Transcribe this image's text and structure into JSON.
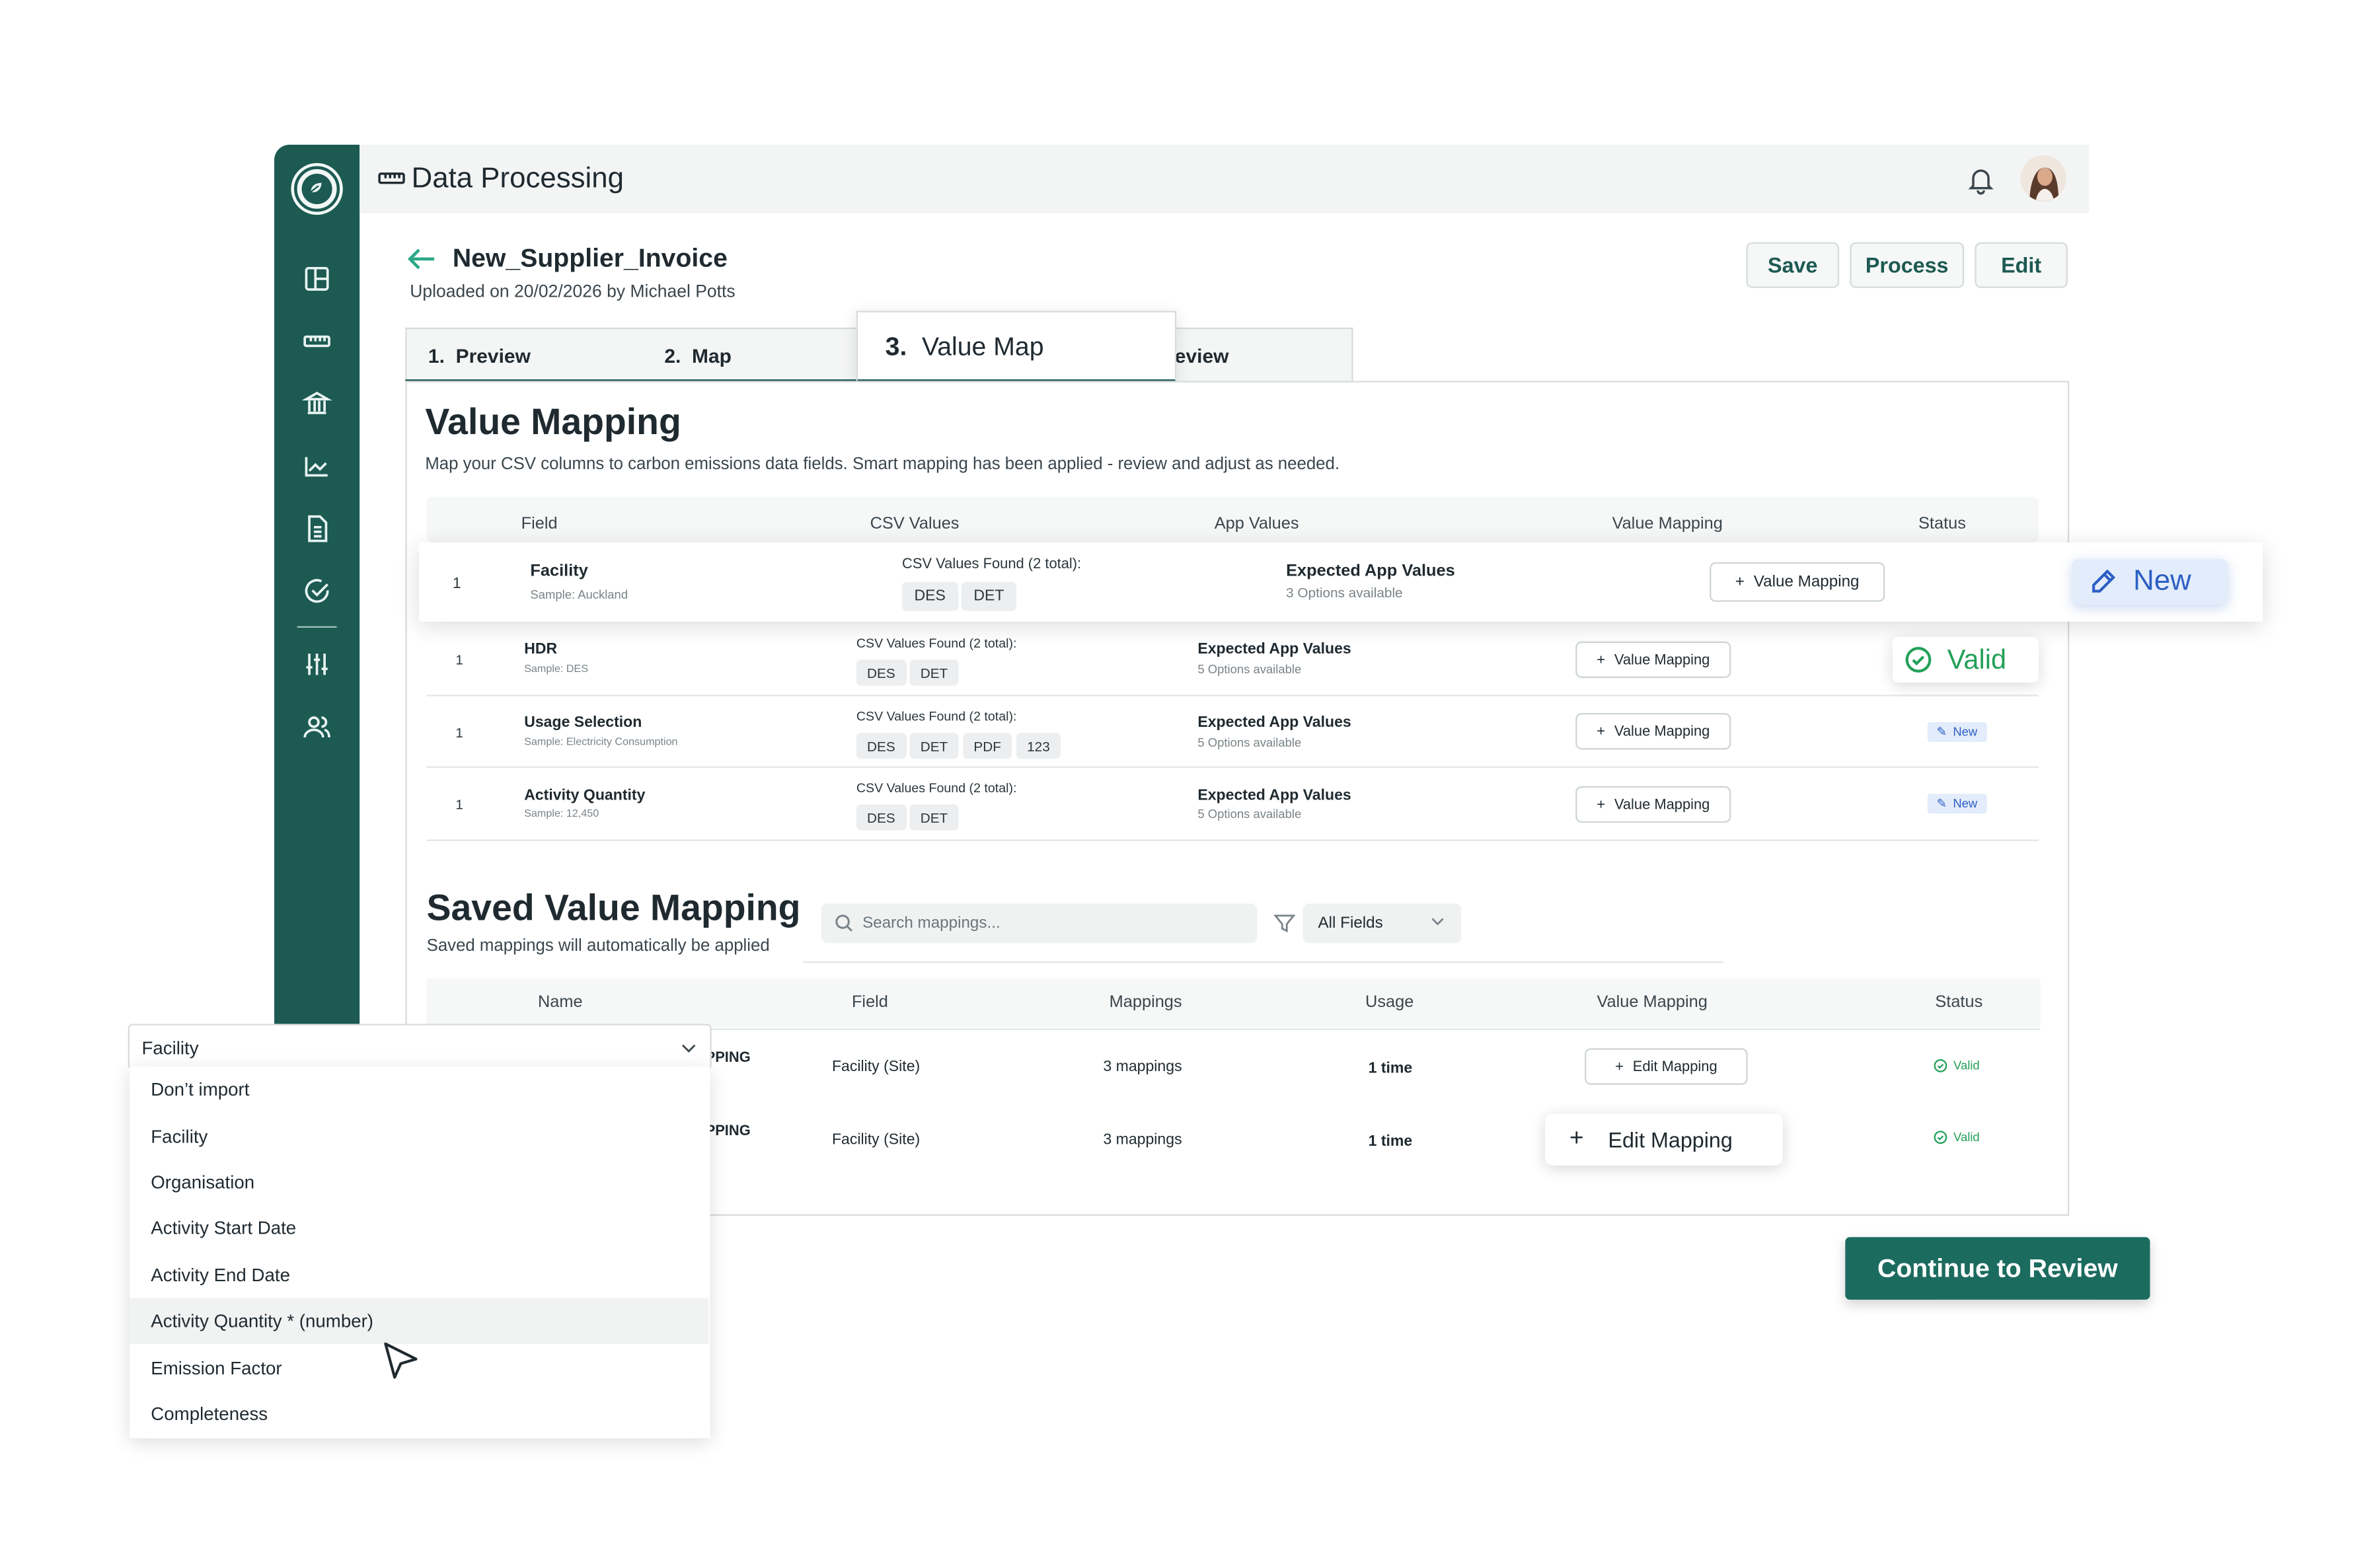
{
  "header": {
    "title": "Data Processing"
  },
  "file": {
    "name": "New_Supplier_Invoice",
    "uploaded": "Uploaded on 20/02/2026 by Michael Potts"
  },
  "actions": {
    "save": "Save",
    "process": "Process",
    "edit": "Edit"
  },
  "tabs": {
    "preview": "1.  Preview",
    "map": "2.  Map",
    "value_map_num": "3.",
    "value_map": "Value Map",
    "review_partial": "eview"
  },
  "value_mapping": {
    "title": "Value Mapping",
    "description": "Map your CSV columns to carbon emissions data fields. Smart mapping has been applied - review and adjust as needed.",
    "columns": {
      "field": "Field",
      "csv_values": "CSV Values",
      "app_values": "App Values",
      "value_mapping": "Value Mapping",
      "status": "Status"
    },
    "rows": [
      {
        "num": "1",
        "field": "Facility",
        "sample": "Sample: Auckland",
        "found": "CSV Values Found (2 total):",
        "chips": [
          "DES",
          "DET"
        ],
        "expected": "Expected App Values",
        "options": "3 Options available",
        "button": "Value Mapping",
        "status": "New"
      },
      {
        "num": "1",
        "field": "HDR",
        "sample": "Sample: DES",
        "found": "CSV Values Found (2 total):",
        "chips": [
          "DES",
          "DET"
        ],
        "expected": "Expected App Values",
        "options": "5 Options available",
        "button": "Value Mapping",
        "status": "Valid"
      },
      {
        "num": "1",
        "field": "Usage Selection",
        "sample": "Sample: Electricity Consumption",
        "found": "CSV Values Found (2 total):",
        "chips": [
          "DES",
          "DET",
          "PDF",
          "123"
        ],
        "expected": "Expected App Values",
        "options": "5 Options available",
        "button": "Value Mapping",
        "status": "New"
      },
      {
        "num": "1",
        "field": "Activity Quantity",
        "sample": "Sample: 12,450",
        "found": "CSV Values Found (2 total):",
        "chips": [
          "DES",
          "DET"
        ],
        "expected": "Expected App Values",
        "options": "5 Options available",
        "button": "Value Mapping",
        "status": "New"
      }
    ]
  },
  "saved": {
    "title": "Saved Value Mapping",
    "subtitle": "Saved mappings will automatically be applied",
    "search_placeholder": "Search mappings...",
    "filter_value": "All Fields",
    "columns": {
      "name": "Name",
      "field": "Field",
      "mappings": "Mappings",
      "usage": "Usage",
      "value_mapping": "Value Mapping",
      "status": "Status"
    },
    "rows": [
      {
        "name_partial": "PPING",
        "field": "Facility (Site)",
        "mappings": "3 mappings",
        "usage": "1 time",
        "button": "Edit Mapping",
        "status": "Valid"
      },
      {
        "name_partial": "PPING",
        "field": "Facility (Site)",
        "mappings": "3 mappings",
        "usage": "1 time",
        "button": "Edit Mapping",
        "status": "Valid"
      }
    ]
  },
  "continue_button": "Continue to Review",
  "dropdown": {
    "selected": "Facility",
    "options": [
      "Don’t import",
      "Facility",
      "Organisation",
      "Activity Start Date",
      "Activity End Date",
      "Activity Quantity * (number)",
      "Emission Factor",
      "Completeness"
    ],
    "highlighted_index": 5
  },
  "colors": {
    "brand": "#1c5a52",
    "accent": "#2aa889",
    "valid": "#23a059",
    "new": "#2c5fc4"
  }
}
